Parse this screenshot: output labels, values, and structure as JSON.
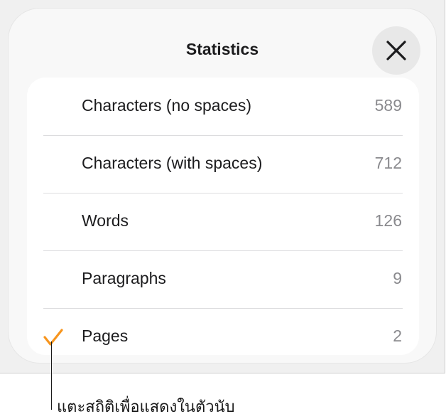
{
  "window": {
    "title": "Statistics"
  },
  "close": {
    "label": "Close"
  },
  "stats": [
    {
      "label": "Characters (no spaces)",
      "value": "589",
      "checked": false
    },
    {
      "label": "Characters (with spaces)",
      "value": "712",
      "checked": false
    },
    {
      "label": "Words",
      "value": "126",
      "checked": false
    },
    {
      "label": "Paragraphs",
      "value": "9",
      "checked": false
    },
    {
      "label": "Pages",
      "value": "2",
      "checked": true
    }
  ],
  "callout": {
    "text": "แตะสถิติเพื่อแสดงในตัวนับ"
  },
  "colors": {
    "accent": "#f7951e",
    "sheet": "#f8f8f8",
    "list": "#ffffff"
  },
  "icons": {
    "close": "close-icon",
    "check": "checkmark-icon"
  }
}
